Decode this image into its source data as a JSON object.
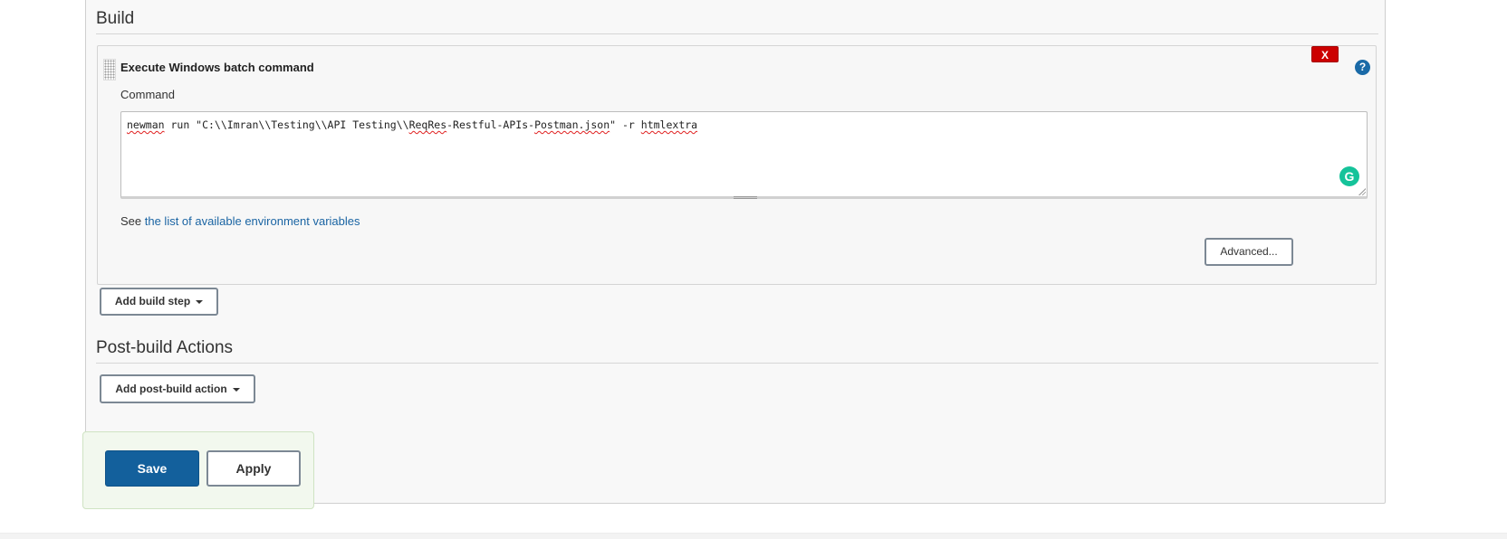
{
  "build": {
    "title": "Build",
    "step": {
      "title": "Execute Windows batch command",
      "delete_label": "X",
      "help_label": "?",
      "command_label": "Command",
      "command_parts": {
        "p1": "newman",
        "p2": " run \"C:\\\\Imran\\\\Testing\\\\API Testing\\\\",
        "p3": "ReqRes",
        "p4": "-Restful-APIs-",
        "p5": "Postman.json",
        "p6": "\" -r ",
        "p7": "htmlextra"
      },
      "grammarly_label": "G",
      "env_prefix": "See ",
      "env_link": "the list of available environment variables",
      "advanced_label": "Advanced..."
    },
    "add_step_label": "Add build step"
  },
  "post_build": {
    "title": "Post-build Actions",
    "add_action_label": "Add post-build action"
  },
  "footer": {
    "save_label": "Save",
    "apply_label": "Apply"
  },
  "colors": {
    "primary": "#13609c",
    "danger": "#cc0000",
    "link": "#1a64a3",
    "grammarly": "#15c39a"
  }
}
